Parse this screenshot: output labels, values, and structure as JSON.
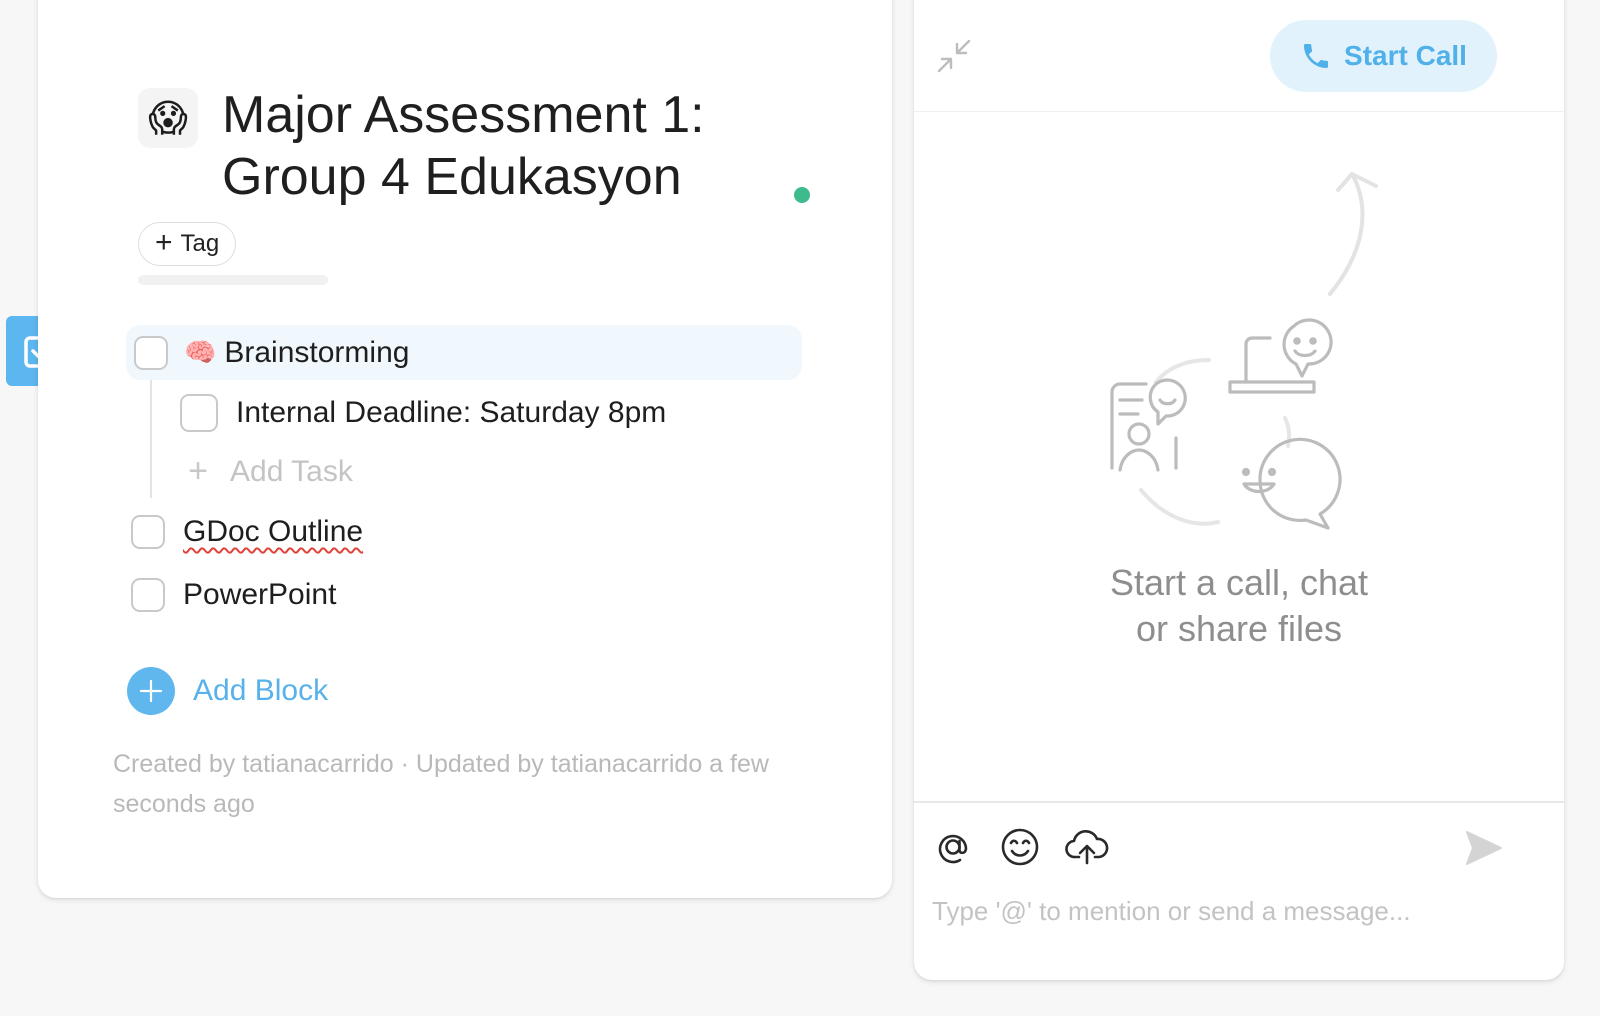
{
  "doc": {
    "emoji": "😱",
    "title": "Major Assessment 1: Group 4 Edukasyon",
    "tag_label": "Tag",
    "tasks": [
      {
        "emoji": "🧠",
        "label": "Brainstorming",
        "checked": false
      },
      {
        "label": "Internal Deadline: Saturday 8pm",
        "checked": false,
        "indent": 1
      },
      {
        "label": "GDoc Outline",
        "checked": false
      },
      {
        "label": "PowerPoint",
        "checked": false
      }
    ],
    "add_task_label": "Add Task",
    "add_block_label": "Add Block",
    "meta": "Created by tatianacarrido · Updated by tatianacarrido a few seconds ago"
  },
  "chat": {
    "start_call_label": "Start Call",
    "empty_state": [
      "Start a call, chat",
      "or share files"
    ],
    "input_placeholder": "Type '@' to mention or send a message..."
  },
  "colors": {
    "accent": "#5cb6ef",
    "status_online": "#3dbb8c",
    "call_button_bg": "#e2f2fc"
  },
  "icons": [
    "task-check-icon",
    "collapse-icon",
    "phone-icon",
    "mention-icon",
    "emoji-icon",
    "upload-icon",
    "send-icon",
    "plus-icon"
  ]
}
